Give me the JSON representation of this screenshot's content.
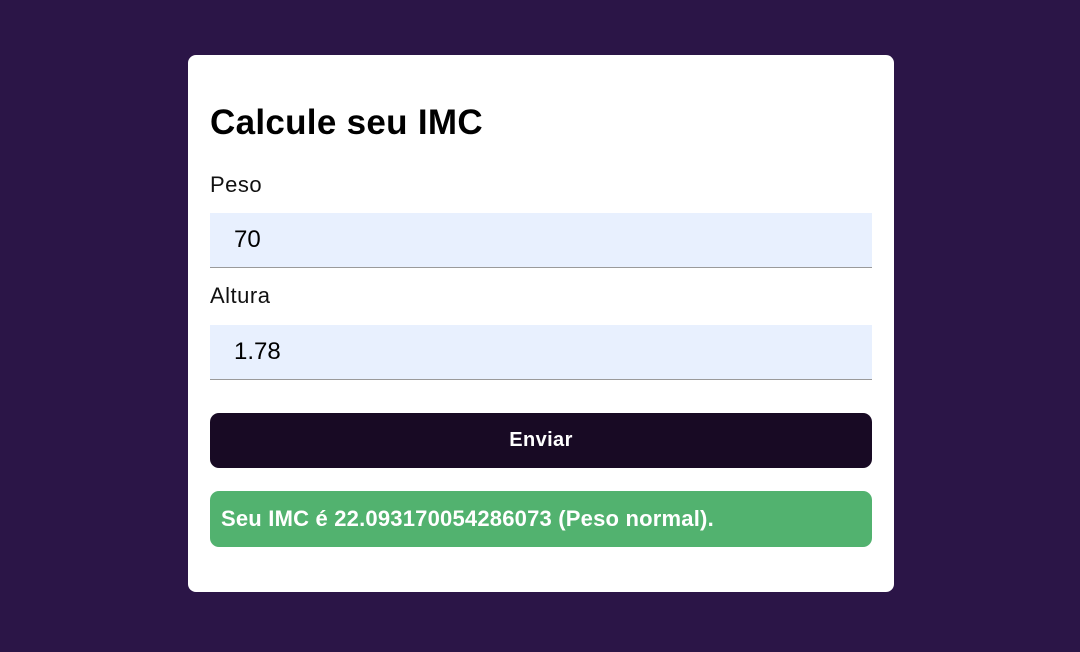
{
  "form": {
    "title": "Calcule seu IMC",
    "weight_label": "Peso",
    "weight_value": "70",
    "height_label": "Altura",
    "height_value": "1.78",
    "submit_label": "Enviar"
  },
  "result": {
    "text": "Seu IMC é 22.093170054286073 (Peso normal).",
    "status_color": "#52b26f"
  },
  "colors": {
    "background": "#2b1547",
    "card": "#ffffff",
    "input_fill": "#e8f0fe",
    "button": "#180a24"
  }
}
